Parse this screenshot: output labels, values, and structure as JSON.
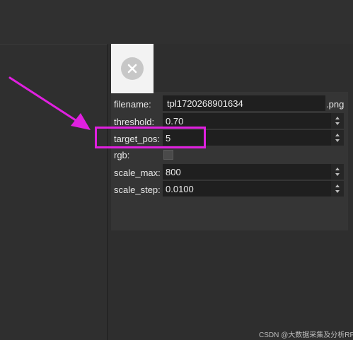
{
  "properties": {
    "filename": {
      "label": "filename:",
      "value": "tpl1720268901634",
      "suffix": ".png"
    },
    "threshold": {
      "label": "threshold:",
      "value": "0.70"
    },
    "target_pos": {
      "label": "target_pos:",
      "value": "5"
    },
    "rgb": {
      "label": "rgb:",
      "checked": false
    },
    "scale_max": {
      "label": "scale_max:",
      "value": "800"
    },
    "scale_step": {
      "label": "scale_step:",
      "value": "0.0100"
    }
  },
  "thumbnail": {
    "icon": "close-icon"
  },
  "annotation": {
    "color": "#e020e0",
    "highlight": "target_pos"
  },
  "watermark": "CSDN @大数据采集及分析RPA"
}
